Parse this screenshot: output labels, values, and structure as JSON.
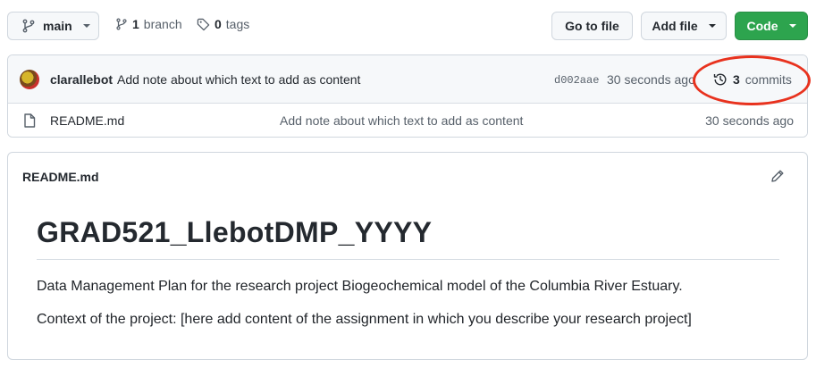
{
  "toolbar": {
    "branch_label": "main",
    "branches_count": "1",
    "branches_word": "branch",
    "tags_count": "0",
    "tags_word": "tags",
    "go_to_file": "Go to file",
    "add_file": "Add file",
    "code": "Code"
  },
  "latest_commit": {
    "author": "clarallebot",
    "message": "Add note about which text to add as content",
    "sha": "d002aae",
    "time": "30 seconds ago",
    "commits_count": "3",
    "commits_word": "commits"
  },
  "files": [
    {
      "name": "README.md",
      "commit_message": "Add note about which text to add as content",
      "time": "30 seconds ago"
    }
  ],
  "readme": {
    "header": "README.md",
    "title": "GRAD521_LlebotDMP_YYYY",
    "paragraph1": "Data Management Plan for the research project Biogeochemical model of the Columbia River Estuary.",
    "paragraph2": "Context of the project: [here add content of the assignment in which you describe your research project]"
  },
  "colors": {
    "code_button": "#2da44e",
    "annotation_circle": "#e8321e"
  }
}
